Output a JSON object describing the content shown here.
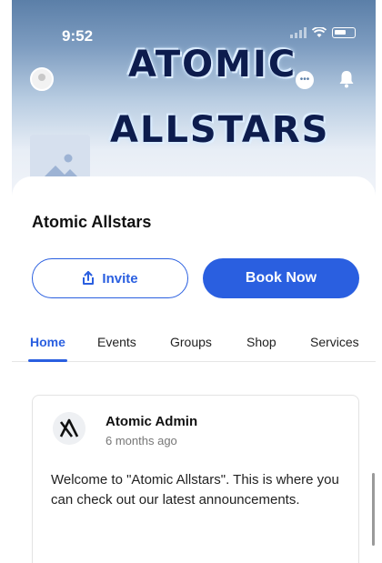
{
  "status_bar": {
    "time": "9:52"
  },
  "hero": {
    "wordmark_line1": "ATOMIC",
    "wordmark_line2": "ALLSTARS"
  },
  "header": {
    "icons": [
      "avatar",
      "chat-icon",
      "bell-icon"
    ]
  },
  "page": {
    "title": "Atomic Allstars"
  },
  "actions": {
    "invite_label": "Invite",
    "book_label": "Book Now"
  },
  "tabs": [
    {
      "label": "Home",
      "active": true
    },
    {
      "label": "Events",
      "active": false
    },
    {
      "label": "Groups",
      "active": false
    },
    {
      "label": "Shop",
      "active": false
    },
    {
      "label": "Services",
      "active": false
    }
  ],
  "post": {
    "author": "Atomic Admin",
    "time": "6 months ago",
    "body": "Welcome to \"Atomic Allstars\". This is where you can check out our latest announcements."
  },
  "colors": {
    "accent": "#2a5fe0",
    "hero_top": "#5b7fa8",
    "wordmark": "#0d1c4d"
  }
}
